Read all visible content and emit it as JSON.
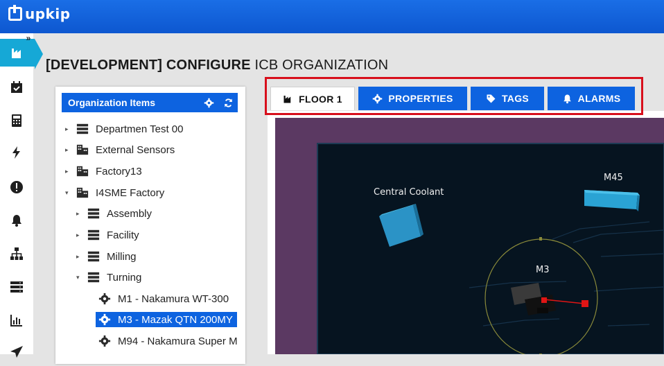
{
  "app": {
    "logo_text": "upkip"
  },
  "sidebar": {
    "expand_glyph": "»",
    "items": [
      {
        "icon": "factory-icon",
        "active": true
      },
      {
        "icon": "calendar-icon"
      },
      {
        "icon": "calculator-icon"
      },
      {
        "icon": "bolt-icon"
      },
      {
        "icon": "alert-icon"
      },
      {
        "icon": "bell-icon"
      },
      {
        "icon": "sitemap-icon"
      },
      {
        "icon": "server-icon"
      },
      {
        "icon": "chart-icon"
      },
      {
        "icon": "send-icon"
      }
    ]
  },
  "page": {
    "title_bold": "[DEVELOPMENT] CONFIGURE",
    "title_rest": "ICB ORGANIZATION"
  },
  "org": {
    "header": "Organization Items",
    "tree": [
      {
        "label": "Departmen Test 00",
        "icon": "server-icon",
        "caret": "▸"
      },
      {
        "label": "External Sensors",
        "icon": "building-icon",
        "caret": "▸"
      },
      {
        "label": "Factory13",
        "icon": "building-icon",
        "caret": "▸"
      },
      {
        "label": "I4SME Factory",
        "icon": "building-icon",
        "caret": "▾"
      },
      {
        "label": "Assembly",
        "icon": "server-icon",
        "caret": "▸"
      },
      {
        "label": "Facility",
        "icon": "server-icon",
        "caret": "▸"
      },
      {
        "label": "Milling",
        "icon": "server-icon",
        "caret": "▸"
      },
      {
        "label": "Turning",
        "icon": "server-icon",
        "caret": "▾"
      },
      {
        "label": "M1 - Nakamura WT-300",
        "icon": "gear-icon",
        "caret": ""
      },
      {
        "label": "M3 - Mazak QTN 200MY",
        "icon": "gear-icon",
        "caret": "",
        "selected": true
      },
      {
        "label": "M94 - Nakamura Super M",
        "icon": "gear-icon",
        "caret": ""
      }
    ]
  },
  "tabs": [
    {
      "label": "FLOOR 1",
      "icon": "factory-icon",
      "active": true
    },
    {
      "label": "PROPERTIES",
      "icon": "gear-icon"
    },
    {
      "label": "TAGS",
      "icon": "tag-icon"
    },
    {
      "label": "ALARMS",
      "icon": "bell-icon"
    }
  ],
  "floor": {
    "machines": [
      {
        "label": "Central Coolant"
      },
      {
        "label": "M45"
      },
      {
        "label": "M3"
      }
    ]
  },
  "colors": {
    "brand_blue": "#0d63e0",
    "active_teal": "#16a8d6",
    "highlight_red": "#d80f1c",
    "floor_purple": "#5b3962",
    "floor_dark": "#061420",
    "machine_cyan": "#2aa3d4"
  }
}
